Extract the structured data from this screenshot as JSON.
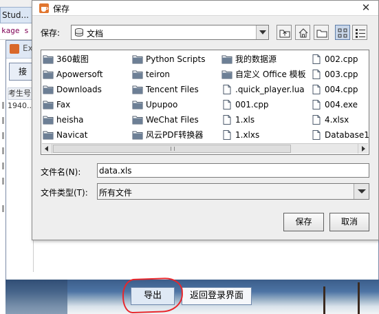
{
  "ide": {
    "tab_label": "Stud...",
    "code_snippet": "kage s"
  },
  "exam_window": {
    "title": "Ex",
    "top_button": "接",
    "table_header": "考生号",
    "first_cell": "1940...",
    "export_button": "导出",
    "back_button": "返回登录界面"
  },
  "dialog": {
    "title": "保存",
    "close": "✕",
    "save_in_label": "保存:",
    "current_folder": "文档",
    "toolbar": [
      "up-folder-icon",
      "home-icon",
      "new-folder-icon",
      "list-view-icon",
      "details-view-icon"
    ],
    "files": [
      {
        "name": "360截图",
        "type": "folder"
      },
      {
        "name": "Apowersoft",
        "type": "folder"
      },
      {
        "name": "Downloads",
        "type": "folder"
      },
      {
        "name": "Fax",
        "type": "folder"
      },
      {
        "name": "heisha",
        "type": "folder"
      },
      {
        "name": "Navicat",
        "type": "folder"
      },
      {
        "name": "Python Scripts",
        "type": "folder"
      },
      {
        "name": "teiron",
        "type": "folder"
      },
      {
        "name": "Tencent Files",
        "type": "folder"
      },
      {
        "name": "Upupoo",
        "type": "folder"
      },
      {
        "name": "WeChat Files",
        "type": "folder"
      },
      {
        "name": "风云PDF转换器",
        "type": "folder"
      },
      {
        "name": "我的数据源",
        "type": "folder"
      },
      {
        "name": "自定义 Office 模板",
        "type": "folder"
      },
      {
        "name": ".quick_player.lua",
        "type": "file"
      },
      {
        "name": "001.cpp",
        "type": "file"
      },
      {
        "name": "1.xls",
        "type": "file"
      },
      {
        "name": "1.xlxs",
        "type": "file"
      },
      {
        "name": "002.cpp",
        "type": "file"
      },
      {
        "name": "003.cpp",
        "type": "file"
      },
      {
        "name": "004.cpp",
        "type": "file"
      },
      {
        "name": "004.exe",
        "type": "file"
      },
      {
        "name": "4.xlsx",
        "type": "file"
      },
      {
        "name": "Database1.",
        "type": "file"
      }
    ],
    "file_name_label": "文件名(N):",
    "file_name_value": "data.xls",
    "file_type_label": "文件类型(T):",
    "file_type_value": "所有文件",
    "save_button": "保存",
    "cancel_button": "取消"
  },
  "colors": {
    "dialog_bg": "#eeeeee",
    "folder_icon": "#5b6f86",
    "highlight_circle": "#e8262b"
  }
}
